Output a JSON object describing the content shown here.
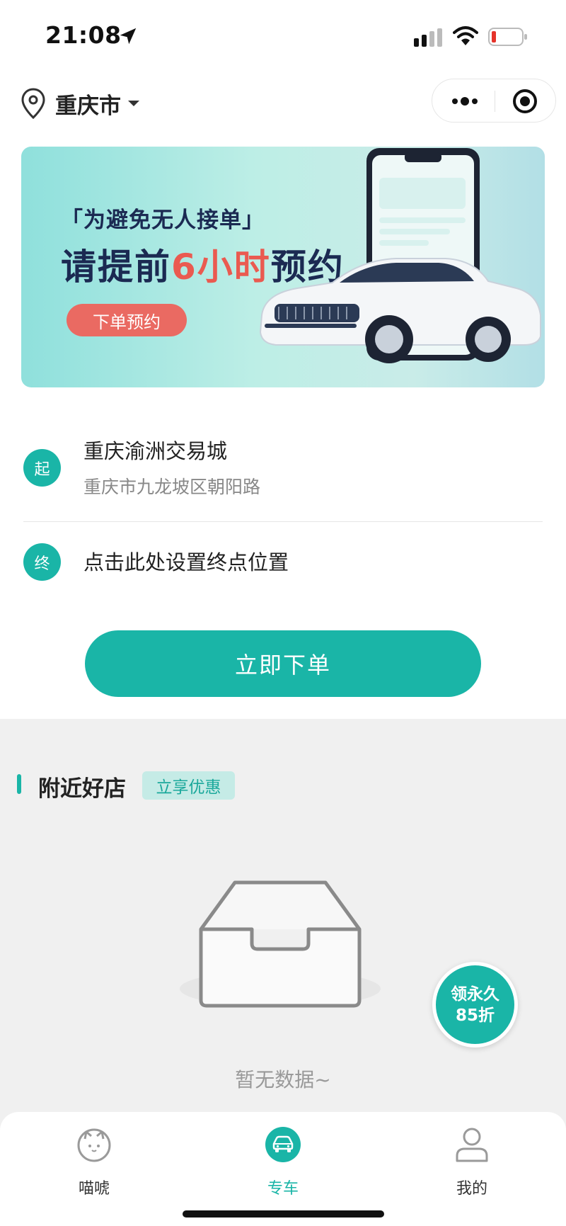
{
  "status_bar": {
    "time": "21:08"
  },
  "header": {
    "city": "重庆市"
  },
  "banner": {
    "subtitle": "「为避免无人接单」",
    "title_prefix": "请提前",
    "title_highlight": "6小时",
    "title_suffix": "预约",
    "button": "下单预约"
  },
  "route": {
    "start_badge": "起",
    "start_name": "重庆渝洲交易城",
    "start_address": "重庆市九龙坡区朝阳路",
    "end_badge": "终",
    "end_placeholder": "点击此处设置终点位置"
  },
  "order_button": "立即下单",
  "nearby": {
    "title": "附近好店",
    "tag": "立享优惠",
    "empty_text": "暂无数据~"
  },
  "coupon": {
    "line1": "领永久",
    "line2": "85折"
  },
  "tabs": [
    {
      "label": "喵唬",
      "icon": "cat-icon",
      "active": false
    },
    {
      "label": "专车",
      "icon": "car-icon",
      "active": true
    },
    {
      "label": "我的",
      "icon": "user-icon",
      "active": false
    }
  ],
  "colors": {
    "accent": "#1ab5a7",
    "highlight": "#ea5a50",
    "banner_button": "#ea6a62"
  }
}
